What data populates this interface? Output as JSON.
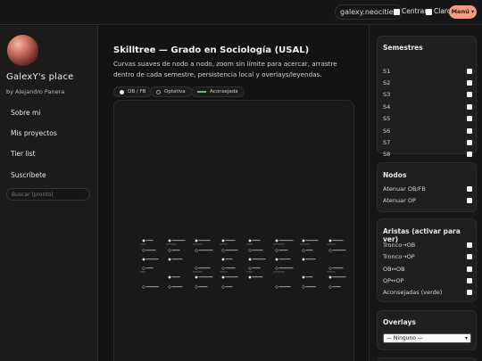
{
  "topbar": {
    "site": "galexy.neocities",
    "center_label": "Centrar",
    "light_label": "Claro",
    "menu_label": "Menú ▾"
  },
  "sidebar": {
    "brand": "GalexY's place",
    "author": "by Alejandro Panera",
    "nav": [
      {
        "label": "Sobre mi"
      },
      {
        "label": "Mis proyectos"
      },
      {
        "label": "Tier list"
      },
      {
        "label": "Suscríbete"
      }
    ],
    "search_placeholder": "Buscar (pronto)"
  },
  "main": {
    "title": "Skilltree — Grado en Sociología (USAL)",
    "subtitle": "Curvas suaves de nodo a nodo, zoom sin límite para acercar, arrastre dentro de cada semestre, persistencia local y overlays/leyendas.",
    "legend": {
      "ob": "OB / FB",
      "op": "Optativa",
      "advised": "Aconsejada"
    }
  },
  "panel": {
    "semesters": {
      "title": "Semestres",
      "items": [
        "S1",
        "S2",
        "S3",
        "S4",
        "S5",
        "S6",
        "S7",
        "S8"
      ]
    },
    "nodes": {
      "title": "Nodos",
      "items": [
        "Atenuar OB/FB",
        "Atenuar OP"
      ]
    },
    "edges": {
      "title": "Aristas (activar para ver)",
      "items": [
        "Tronco→OB",
        "Tronco→OP",
        "OB↔OB",
        "OP↔OP",
        "Aconsejadas (verde)"
      ]
    },
    "overlays": {
      "title": "Overlays",
      "selected": "— Ninguno —"
    }
  },
  "colors": {
    "accent": "#f49a86",
    "advised": "#5fbf7a",
    "background": "#131313"
  }
}
